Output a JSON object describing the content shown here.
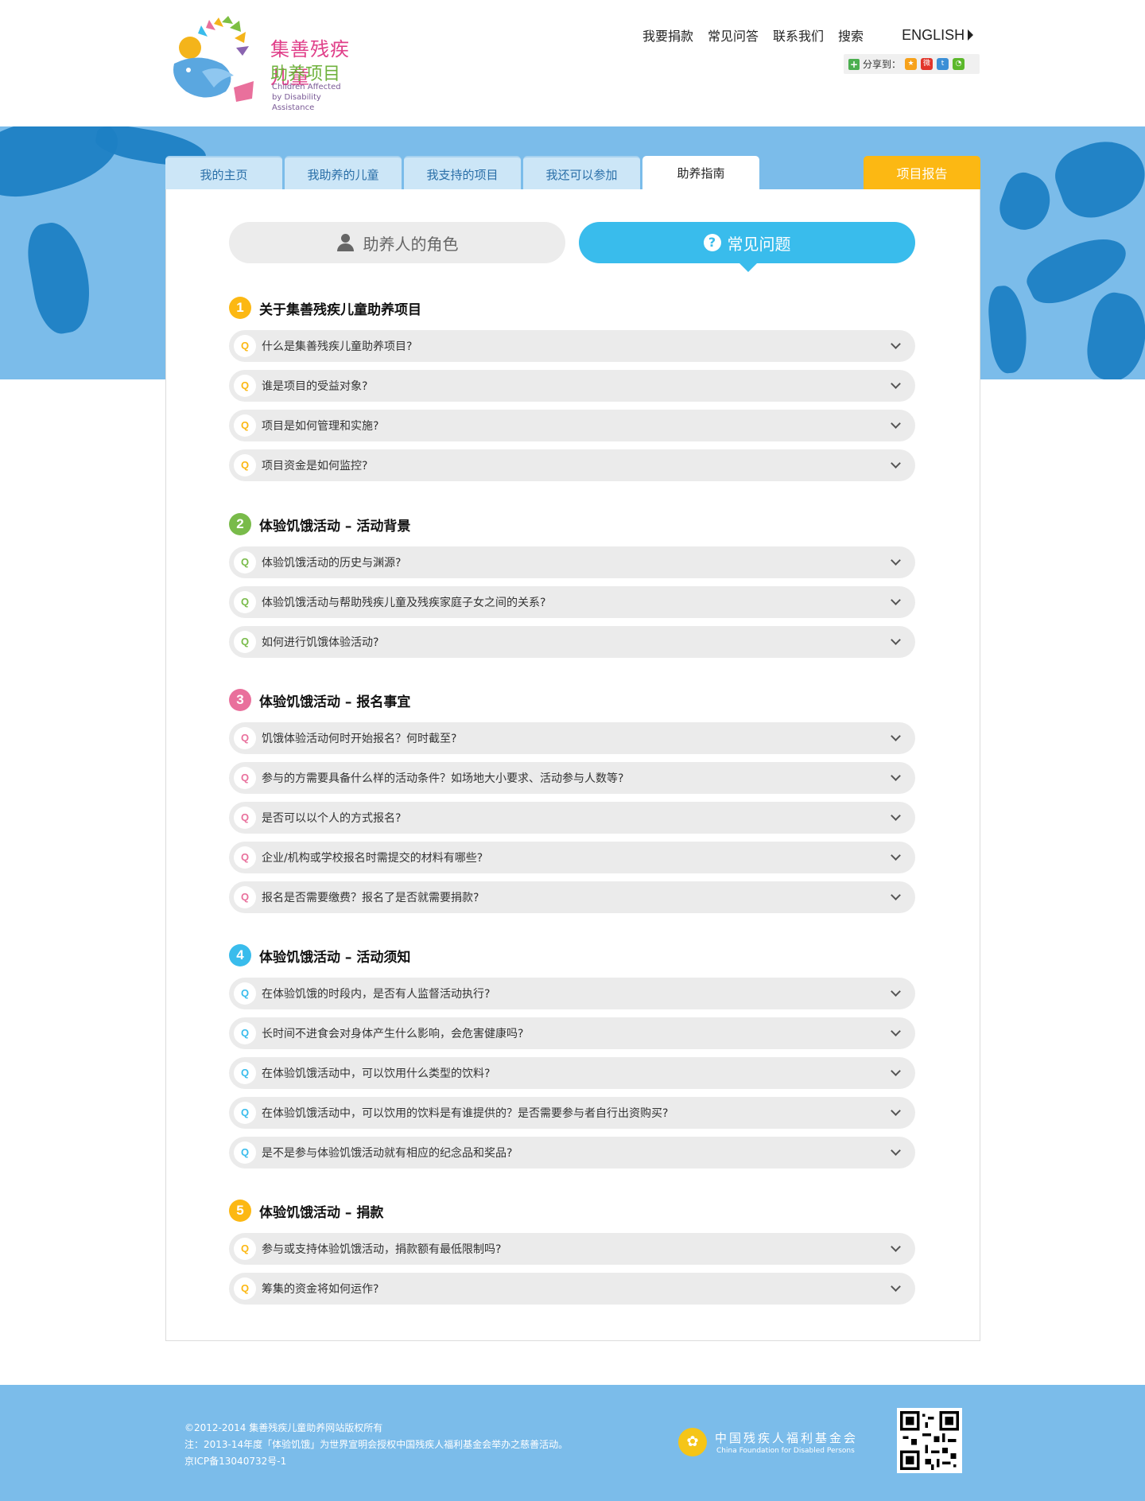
{
  "header": {
    "logo": {
      "line1": "集善残疾儿童",
      "line2": "助养项目",
      "en_line1": "Children Affected",
      "en_line2": "by Disability Assistance"
    },
    "nav": [
      "我要捐款",
      "常见问答",
      "联系我们",
      "搜索"
    ],
    "english_label": "ENGLISH",
    "share_label": "分享到："
  },
  "tabs": {
    "items": [
      "我的主页",
      "我助养的儿童",
      "我支持的项目",
      "我还可以参加",
      "助养指南"
    ],
    "active": "助养指南",
    "report": "项目报告"
  },
  "toggle": {
    "roles_label": "助养人的角色",
    "faq_label": "常见问题",
    "active": "faq"
  },
  "colors": {
    "yellow": "#fcb813",
    "green": "#79bb4a",
    "pink": "#e9709c",
    "blue": "#39bcec",
    "banner": "#7bbcea"
  },
  "sections": [
    {
      "num": "1",
      "title": "关于集善残疾儿童助养项目",
      "color": "#fcb813",
      "questions": [
        "什么是集善残疾儿童助养项目?",
        "谁是项目的受益对象?",
        "项目是如何管理和实施?",
        "项目资金是如何监控?"
      ]
    },
    {
      "num": "2",
      "title": "体验饥饿活动 – 活动背景",
      "color": "#79bb4a",
      "questions": [
        "体验饥饿活动的历史与渊源?",
        "体验饥饿活动与帮助残疾儿童及残疾家庭子女之间的关系?",
        "如何进行饥饿体验活动?"
      ]
    },
    {
      "num": "3",
      "title": "体验饥饿活动 – 报名事宜",
      "color": "#e9709c",
      "questions": [
        "饥饿体验活动何时开始报名？何时截至?",
        "参与的方需要具备什么样的活动条件？如场地大小要求、活动参与人数等?",
        "是否可以以个人的方式报名?",
        "企业/机构或学校报名时需提交的材料有哪些?",
        "报名是否需要缴费？报名了是否就需要捐款?"
      ]
    },
    {
      "num": "4",
      "title": "体验饥饿活动 – 活动须知",
      "color": "#39bcec",
      "questions": [
        "在体验饥饿的时段内，是否有人监督活动执行?",
        "长时间不进食会对身体产生什么影响，会危害健康吗?",
        "在体验饥饿活动中，可以饮用什么类型的饮料?",
        "在体验饥饿活动中，可以饮用的饮料是有谁提供的？是否需要参与者自行出资购买?",
        "是不是参与体验饥饿活动就有相应的纪念品和奖品?"
      ]
    },
    {
      "num": "5",
      "title": "体验饥饿活动 – 捐款",
      "color": "#fcb813",
      "questions": [
        "参与或支持体验饥饿活动，捐款额有最低限制吗?",
        "筹集的资金将如何运作?"
      ]
    }
  ],
  "footer": {
    "copyright": "©2012-2014 集善残疾儿童助养网站版权所有",
    "note": "注：2013-14年度「体验饥饿」为世界宣明会授权中国残疾人福利基金会举办之慈善活动。",
    "icp": "京ICP备13040732号-1",
    "org_cn": "中国残疾人福利基金会",
    "org_en": "China Foundation for Disabled Persons"
  }
}
